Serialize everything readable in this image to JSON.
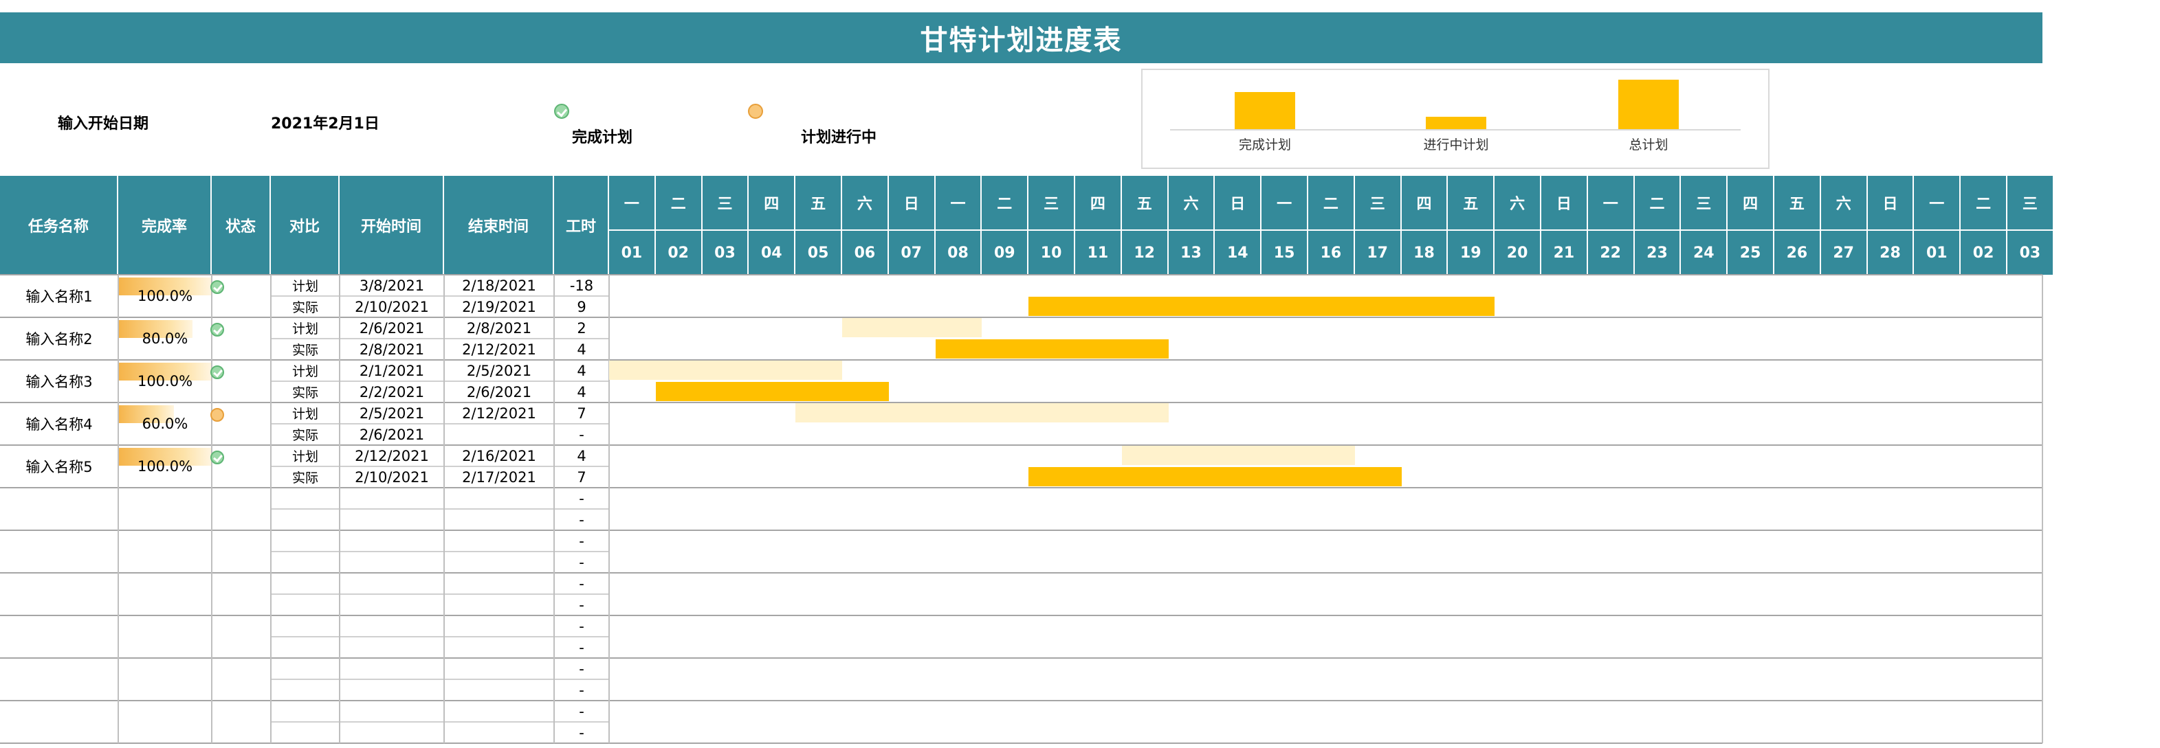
{
  "title": "甘特计划进度表",
  "info": {
    "start_label": "输入开始日期",
    "start_value": "2021年2月1日"
  },
  "legend": {
    "done_label": "完成计划",
    "progress_label": "计划进行中",
    "done_icon": "check-circle-icon",
    "progress_icon": "orange-circle-icon"
  },
  "summary_chart": {
    "categories": [
      "完成计划",
      "进行中计划",
      "总计划"
    ],
    "values": [
      3,
      1,
      4
    ]
  },
  "columns": {
    "task": "任务名称",
    "rate": "完成率",
    "status": "状态",
    "compare": "对比",
    "start": "开始时间",
    "end": "结束时间",
    "hours": "工时"
  },
  "calendar": {
    "weekdays": [
      "一",
      "二",
      "三",
      "四",
      "五",
      "六",
      "日",
      "一",
      "二",
      "三",
      "四",
      "五",
      "六",
      "日",
      "一",
      "二",
      "三",
      "四",
      "五",
      "六",
      "日",
      "一",
      "二",
      "三",
      "四",
      "五",
      "六",
      "日",
      "一",
      "二",
      "三"
    ],
    "days": [
      "01",
      "02",
      "03",
      "04",
      "05",
      "06",
      "07",
      "08",
      "09",
      "10",
      "11",
      "12",
      "13",
      "14",
      "15",
      "16",
      "17",
      "18",
      "19",
      "20",
      "21",
      "22",
      "23",
      "24",
      "25",
      "26",
      "27",
      "28",
      "01",
      "02",
      "03"
    ]
  },
  "tasks": [
    {
      "name": "输入名称1",
      "rate": "100.0%",
      "rate_value": 1.0,
      "status": "done",
      "plan": {
        "label": "计划",
        "start": "3/8/2021",
        "end": "2/18/2021",
        "hours": "-18"
      },
      "actual": {
        "label": "实际",
        "start": "2/10/2021",
        "end": "2/19/2021",
        "hours": "9"
      }
    },
    {
      "name": "输入名称2",
      "rate": "80.0%",
      "rate_value": 0.8,
      "status": "done",
      "plan": {
        "label": "计划",
        "start": "2/6/2021",
        "end": "2/8/2021",
        "hours": "2"
      },
      "actual": {
        "label": "实际",
        "start": "2/8/2021",
        "end": "2/12/2021",
        "hours": "4"
      }
    },
    {
      "name": "输入名称3",
      "rate": "100.0%",
      "rate_value": 1.0,
      "status": "done",
      "plan": {
        "label": "计划",
        "start": "2/1/2021",
        "end": "2/5/2021",
        "hours": "4"
      },
      "actual": {
        "label": "实际",
        "start": "2/2/2021",
        "end": "2/6/2021",
        "hours": "4"
      }
    },
    {
      "name": "输入名称4",
      "rate": "60.0%",
      "rate_value": 0.6,
      "status": "progress",
      "plan": {
        "label": "计划",
        "start": "2/5/2021",
        "end": "2/12/2021",
        "hours": "7"
      },
      "actual": {
        "label": "实际",
        "start": "2/6/2021",
        "end": "",
        "hours": "-"
      }
    },
    {
      "name": "输入名称5",
      "rate": "100.0%",
      "rate_value": 1.0,
      "status": "done",
      "plan": {
        "label": "计划",
        "start": "2/12/2021",
        "end": "2/16/2021",
        "hours": "4"
      },
      "actual": {
        "label": "实际",
        "start": "2/10/2021",
        "end": "2/17/2021",
        "hours": "7"
      }
    }
  ],
  "gantt": [
    {
      "task": "输入名称1",
      "plan_days": null,
      "actual_days": [
        10,
        19
      ]
    },
    {
      "task": "输入名称2",
      "plan_days": [
        6,
        8
      ],
      "actual_days": [
        8,
        12
      ]
    },
    {
      "task": "输入名称3",
      "plan_days": [
        1,
        5
      ],
      "actual_days": [
        2,
        6
      ]
    },
    {
      "task": "输入名称4",
      "plan_days": [
        5,
        12
      ],
      "actual_days": null
    },
    {
      "task": "输入名称5",
      "plan_days": [
        12,
        16
      ],
      "actual_days": [
        10,
        17
      ]
    }
  ],
  "empty_hours": "-",
  "empty_task_rows": 6,
  "colors": {
    "header": "#348a9a",
    "plan": "#fff2cc",
    "actual": "#ffc000"
  }
}
